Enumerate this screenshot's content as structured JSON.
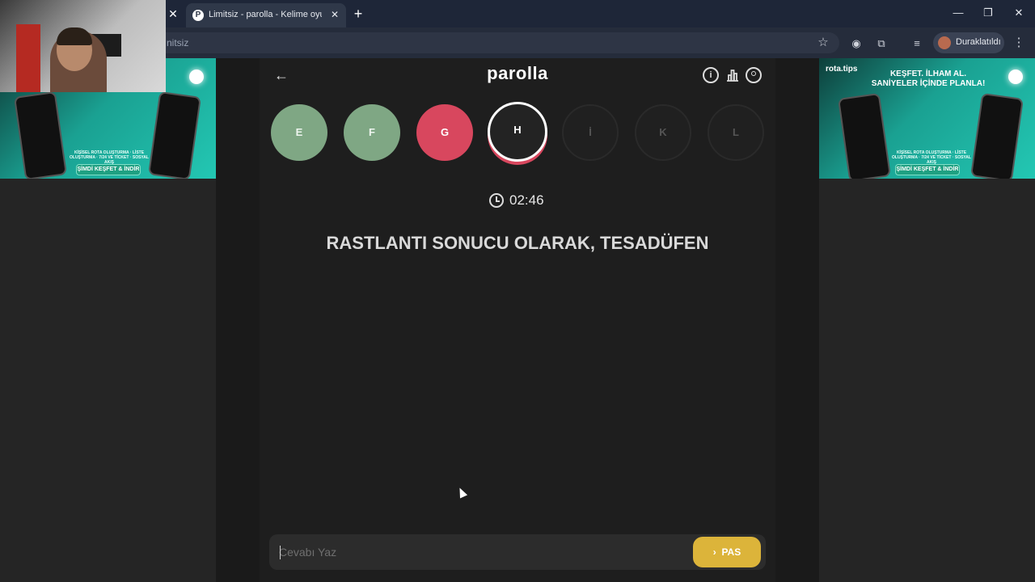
{
  "browser": {
    "tab_title": "Limitsiz - parolla - Kelime oyunu",
    "tab_favicon_letter": "P",
    "close_left_tab": "✕",
    "tab_close": "✕",
    "new_tab": "+",
    "minimize": "—",
    "restore": "❐",
    "close": "✕",
    "url_text": "nitsiz",
    "profile_label": "Duraklatıldı"
  },
  "ads": {
    "right_brand": "rota.tips",
    "right_headline_1": "KEŞFET. İLHAM AL.",
    "right_headline_2": "SANİYELER İÇİNDE PLANLA!",
    "small_text": "KİŞİSEL ROTA OLUŞTURMA · LİSTE OLUŞTURMA · 7/24 VE TİCKET · SOSYAL AKIŞ",
    "cta": "ŞİMDİ KEŞFET & İNDİR",
    "colors": {
      "teal": "#1aa192",
      "cta": "#1fa082"
    }
  },
  "game": {
    "logo": "parolla",
    "timer": "02:46",
    "clue": "RASTLANTI SONUCU OLARAK, TESADÜFEN",
    "letters": [
      {
        "letter": "E",
        "state": "correct"
      },
      {
        "letter": "F",
        "state": "correct"
      },
      {
        "letter": "G",
        "state": "wrong"
      },
      {
        "letter": "H",
        "state": "current"
      },
      {
        "letter": "İ",
        "state": "pending"
      },
      {
        "letter": "K",
        "state": "pending"
      },
      {
        "letter": "L",
        "state": "pending"
      }
    ],
    "answer_placeholder": "Cevabı Yaz",
    "answer_value": "",
    "pass_label": "PAS",
    "colors": {
      "correct": "#7fa784",
      "wrong": "#d8475e",
      "pass": "#dcb43a"
    }
  }
}
